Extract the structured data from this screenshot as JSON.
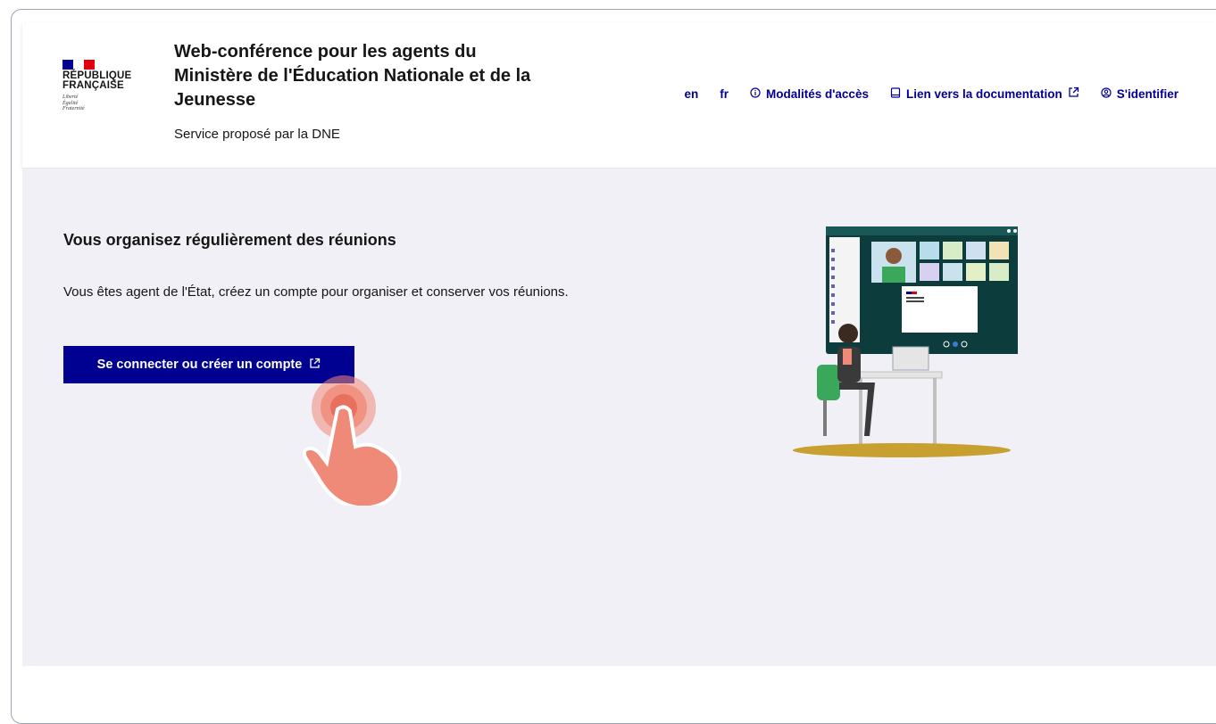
{
  "header": {
    "logo": {
      "line1": "RÉPUBLIQUE",
      "line2": "FRANÇAISE",
      "motto": [
        "Liberté",
        "Égalité",
        "Fraternité"
      ]
    },
    "title": "Web-conférence pour les agents du Ministère de l'Éducation Nationale et de la Jeunesse",
    "tagline": "Service proposé par la DNE",
    "tools": {
      "lang_en": "en",
      "lang_fr": "fr",
      "access": "Modalités d'accès",
      "docs": "Lien vers la documentation",
      "login": "S'identifier"
    }
  },
  "main": {
    "heading": "Vous organisez régulièrement des réunions",
    "lead": "Vous êtes agent de l'État, créez un compte pour organiser et conserver vos réunions.",
    "cta_label": "Se connecter ou créer un compte"
  },
  "colors": {
    "primary": "#000091",
    "background": "#f0f0f6",
    "hand": "#f08a78",
    "screen": "#0c3c3c"
  },
  "icons": [
    "info-icon",
    "book-icon",
    "external-link-icon",
    "user-circle-icon",
    "tap-hand-icon"
  ]
}
